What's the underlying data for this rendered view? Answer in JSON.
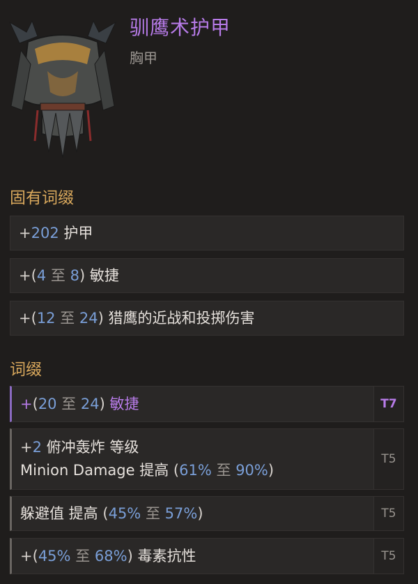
{
  "item": {
    "name": "驯鹰术护甲",
    "type": "胸甲",
    "icon": "chest-armor-icon"
  },
  "implicit": {
    "title": "固有词缀",
    "rows": [
      {
        "prefix": "+",
        "open": "",
        "min": "202",
        "mid": "",
        "max": "",
        "close": "",
        "stat": "护甲"
      },
      {
        "prefix": "+",
        "open": "(",
        "min": "4",
        "mid": "至",
        "max": "8",
        "close": ")",
        "stat": "敏捷"
      },
      {
        "prefix": "+",
        "open": "(",
        "min": "12",
        "mid": "至",
        "max": "24",
        "close": ")",
        "stat": "猎鹰的近战和投掷伤害"
      }
    ]
  },
  "affixes": {
    "title": "词缀",
    "rows": [
      {
        "tier": "T7",
        "prefix": "+",
        "open": "(",
        "min": "20",
        "mid": "至",
        "max": "24",
        "close": ")",
        "stat": "敏捷"
      },
      {
        "tier": "T5",
        "line1_prefix": "+",
        "line1_value": "2",
        "line1_stat": "俯冲轰炸 等级",
        "line2_stat": "Minion Damage 提高",
        "line2_open": "(",
        "line2_min": "61%",
        "line2_mid": "至",
        "line2_max": "90%",
        "line2_close": ")"
      },
      {
        "tier": "T5",
        "stat": "躲避值 提高",
        "open": "(",
        "min": "45%",
        "mid": "至",
        "max": "57%",
        "close": ")"
      },
      {
        "tier": "T5",
        "prefix": "+",
        "open": "(",
        "min": "45%",
        "mid": "至",
        "max": "68%",
        "close": ")",
        "stat": "毒素抗性"
      }
    ]
  },
  "colors": {
    "name": "#b77be8",
    "section": "#d9a85c",
    "number": "#7a9fd8",
    "top_tier": "#b77be8"
  }
}
